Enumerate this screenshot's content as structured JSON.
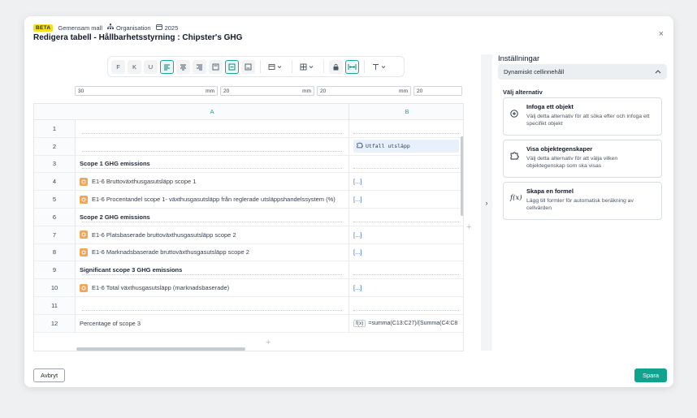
{
  "header": {
    "beta_badge": "BETA",
    "template": "Gemensam mall",
    "organisation": "Organisation",
    "year": "2025",
    "title": "Redigera tabell - Hållbarhetsstyrning : Chipster's GHG",
    "close_label": "×"
  },
  "toolbar": {
    "bold": "F",
    "italic": "K",
    "underline": "U"
  },
  "column_widths": [
    {
      "value": "30",
      "unit": "mm"
    },
    {
      "value": "20",
      "unit": "mm"
    },
    {
      "value": "20",
      "unit": "mm"
    },
    {
      "value": "20",
      "unit": ""
    }
  ],
  "table": {
    "columns": [
      "A",
      "B"
    ],
    "rows": [
      {
        "num": "1",
        "a": "",
        "a_style": "plain",
        "a_icon": false,
        "b": "",
        "b_type": "empty"
      },
      {
        "num": "2",
        "a": "",
        "a_style": "plain",
        "a_icon": false,
        "b": "Utfall utsläpp",
        "b_type": "tag"
      },
      {
        "num": "3",
        "a": "Scope 1 GHG emissions",
        "a_style": "bold",
        "a_icon": false,
        "b": "",
        "b_type": "empty"
      },
      {
        "num": "4",
        "a": "E1-6 Bruttoväxthusgasutsläpp scope 1",
        "a_style": "plain",
        "a_icon": true,
        "b": "[...]",
        "b_type": "ellipsis"
      },
      {
        "num": "5",
        "a": "E1-6 Procentandel scope 1- växthusgasutsläpp från reglerade utsläppshandelssystem (%)",
        "a_style": "plain",
        "a_icon": true,
        "b": "[...]",
        "b_type": "ellipsis"
      },
      {
        "num": "6",
        "a": "Scope 2 GHG emissions",
        "a_style": "bold",
        "a_icon": false,
        "b": "",
        "b_type": "empty"
      },
      {
        "num": "7",
        "a": "E1-6 Platsbaserade bruttoväxthusgasutsläpp scope 2",
        "a_style": "plain",
        "a_icon": true,
        "b": "[...]",
        "b_type": "ellipsis"
      },
      {
        "num": "8",
        "a": "E1-6 Marknadsbaserade bruttoväxthusgasutsläpp scope 2",
        "a_style": "plain",
        "a_icon": true,
        "b": "[...]",
        "b_type": "ellipsis"
      },
      {
        "num": "9",
        "a": "Significant scope 3 GHG emissions",
        "a_style": "bold",
        "a_icon": false,
        "b": "",
        "b_type": "empty"
      },
      {
        "num": "10",
        "a": "E1-6 Total växthusgasutsläpp (marknadsbaserade)",
        "a_style": "plain",
        "a_icon": true,
        "b": "[...]",
        "b_type": "ellipsis"
      },
      {
        "num": "11",
        "a": "",
        "a_style": "plain",
        "a_icon": false,
        "b": "",
        "b_type": "empty"
      },
      {
        "num": "12",
        "a": "Percentage of scope 3",
        "a_style": "plain",
        "a_icon": false,
        "b": "=summa(C13:C27)/(Summa(C4:C8",
        "b_type": "formula"
      }
    ]
  },
  "settings": {
    "title": "Inställningar",
    "accordion_label": "Dynamiskt cellinnehåll",
    "choose_label": "Välj alternativ",
    "options": [
      {
        "title": "Infoga ett objekt",
        "desc": "Välj detta alternativ för att söka efter och infoga ett specifikt objekt",
        "icon": "plus-circle-icon"
      },
      {
        "title": "Visa objektegenskaper",
        "desc": "Välj detta alternativ för att välja vilken objektegenskap som ska visas",
        "icon": "puzzle-icon"
      },
      {
        "title": "Skapa en formel",
        "desc": "Lägg till formler för automatisk beräkning av cellvärden",
        "icon": "function-icon"
      }
    ]
  },
  "footer": {
    "cancel_label": "Avbryt",
    "save_label": "Spara"
  },
  "colors": {
    "accent": "#10a38f",
    "beta": "#f5e11b",
    "object_icon": "#f0a65b",
    "tag_bg": "#e8f1fb"
  }
}
